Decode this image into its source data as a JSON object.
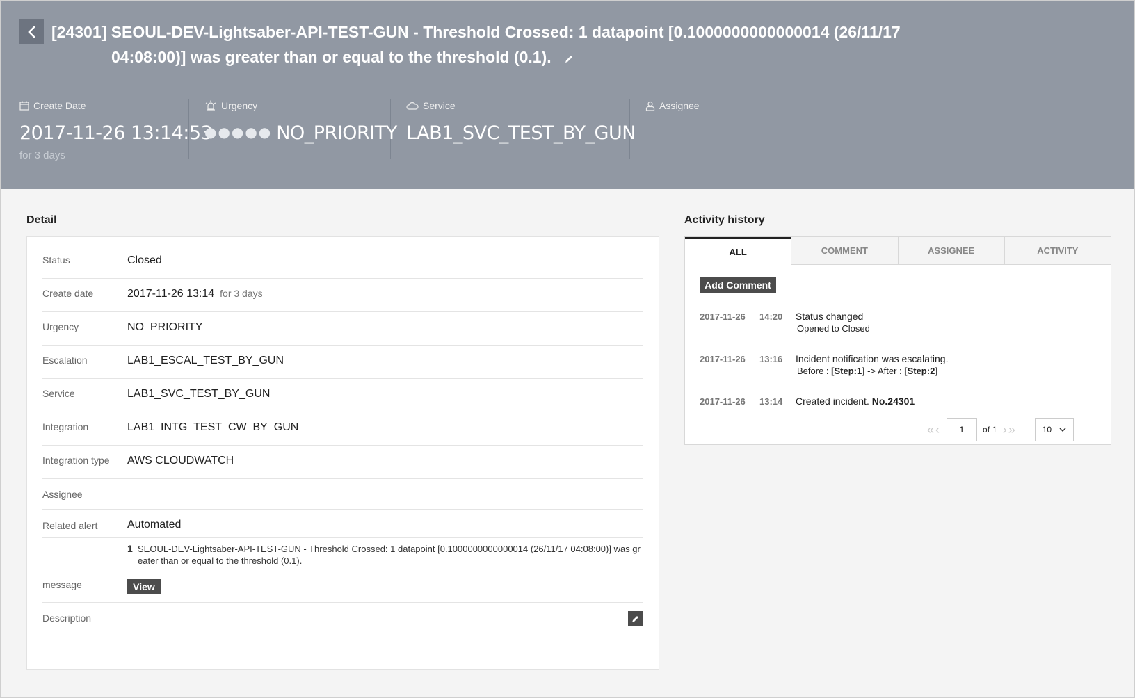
{
  "header": {
    "title_line1": "[24301] SEOUL-DEV-Lightsaber-API-TEST-GUN - Threshold Crossed: 1 datapoint [0.1000000000000014 (26/11/17",
    "title_line2": "04:08:00)] was greater than or equal to the threshold (0.1).",
    "create_date_label": "Create Date",
    "create_date_value": "2017-11-26 13:14:53",
    "create_date_sub": "for 3 days",
    "urgency_label": "Urgency",
    "urgency_value": "NO_PRIORITY",
    "urgency_dots": "●●●●●",
    "service_label": "Service",
    "service_value": "LAB1_SVC_TEST_BY_GUN",
    "assignee_label": "Assignee"
  },
  "detail": {
    "title": "Detail",
    "status_label": "Status",
    "status_value": "Closed",
    "create_label": "Create date",
    "create_value": "2017-11-26 13:14",
    "create_sub": "for 3 days",
    "urgency_label": "Urgency",
    "urgency_value": "NO_PRIORITY",
    "escalation_label": "Escalation",
    "escalation_value": "LAB1_ESCAL_TEST_BY_GUN",
    "service_label": "Service",
    "service_value": "LAB1_SVC_TEST_BY_GUN",
    "integration_label": "Integration",
    "integration_value": "LAB1_INTG_TEST_CW_BY_GUN",
    "integration_type_label": "Integration type",
    "integration_type_value": "AWS CLOUDWATCH",
    "assignee_label": "Assignee",
    "related_label": "Related alert",
    "related_value": "Automated",
    "related_num": "1",
    "related_link": "SEOUL-DEV-Lightsaber-API-TEST-GUN - Threshold Crossed: 1 datapoint [0.1000000000000014 (26/11/17 04:08:00)] was greater than or equal to the threshold (0.1).",
    "message_label": "message",
    "message_button": "View",
    "description_label": "Description"
  },
  "activity": {
    "title": "Activity history",
    "tabs": [
      "ALL",
      "COMMENT",
      "ASSIGNEE",
      "ACTIVITY"
    ],
    "add_comment": "Add Comment",
    "items": [
      {
        "date": "2017-11-26",
        "time": "14:20",
        "line1": "Status changed",
        "line2": "Opened to Closed"
      },
      {
        "date": "2017-11-26",
        "time": "13:16",
        "line1": "Incident notification was escalating.",
        "line2_before": "Before : ",
        "line2_b1": "[Step:1]",
        "line2_mid": " -> After : ",
        "line2_b2": "[Step:2]"
      },
      {
        "date": "2017-11-26",
        "time": "13:14",
        "line1": "Created incident. ",
        "line1_bold": "No.24301"
      }
    ],
    "pager": {
      "page": "1",
      "of_label": "of",
      "total": "1",
      "per_page": "10"
    }
  }
}
